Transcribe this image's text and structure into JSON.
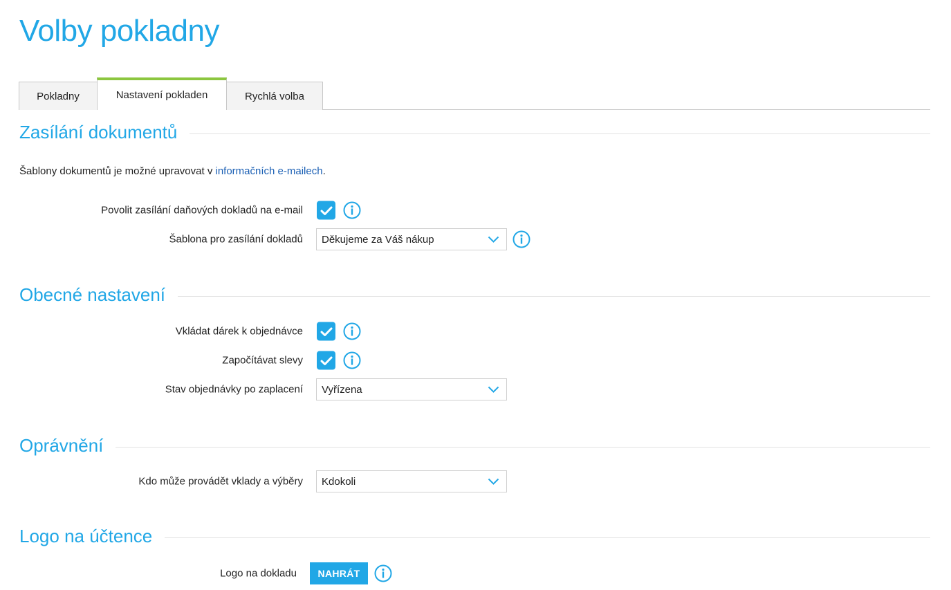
{
  "page": {
    "title": "Volby pokladny"
  },
  "tabs": [
    {
      "label": "Pokladny"
    },
    {
      "label": "Nastavení pokladen"
    },
    {
      "label": "Rychlá volba"
    }
  ],
  "active_tab": "Nastavení pokladen",
  "sections": {
    "documents": {
      "title": "Zasílání dokumentů",
      "info_prefix": "Šablony dokumentů je možné upravovat v ",
      "info_link": "informačních e-mailech",
      "info_suffix": ".",
      "allow_email_label": "Povolit zasílání daňových dokladů na e-mail",
      "allow_email_checked": true,
      "template_label": "Šablona pro zasílání dokladů",
      "template_value": "Děkujeme za Váš nákup"
    },
    "general": {
      "title": "Obecné nastavení",
      "gift_label": "Vkládat dárek k objednávce",
      "gift_checked": true,
      "discounts_label": "Započítávat slevy",
      "discounts_checked": true,
      "status_label": "Stav objednávky po zaplacení",
      "status_value": "Vyřízena"
    },
    "permissions": {
      "title": "Oprávnění",
      "deposits_label": "Kdo může provádět vklady a výběry",
      "deposits_value": "Kdokoli"
    },
    "logo": {
      "title": "Logo na účtence",
      "logo_label": "Logo na dokladu",
      "upload_label": "NAHRÁT"
    }
  },
  "colors": {
    "accent": "#21a7e6",
    "tab_active_border": "#8cc63f",
    "link": "#1a5fb4"
  },
  "icons": {
    "checkbox": "check-icon",
    "info": "info-icon",
    "dropdown": "chevron-down-icon"
  }
}
